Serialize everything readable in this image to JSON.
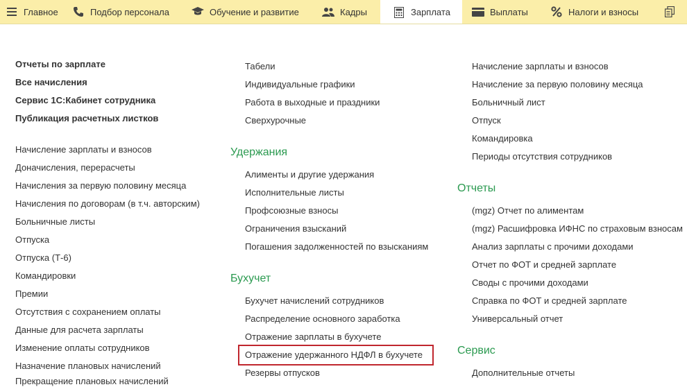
{
  "nav": {
    "tabs": [
      {
        "label": "Главное",
        "icon": "menu-icon"
      },
      {
        "label": "Подбор персонала",
        "icon": "phone-icon"
      },
      {
        "label": "Обучение и развитие",
        "icon": "graduation-cap-icon"
      },
      {
        "label": "Кадры",
        "icon": "users-icon"
      },
      {
        "label": "Зарплата",
        "icon": "calculator-icon",
        "active": true
      },
      {
        "label": "Выплаты",
        "icon": "wallet-icon"
      },
      {
        "label": "Налоги и взносы",
        "icon": "percent-icon"
      },
      {
        "label": "",
        "icon": "copy-icon"
      }
    ]
  },
  "col1": {
    "bold_links": [
      "Отчеты по зарплате",
      "Все начисления",
      "Сервис 1С:Кабинет сотрудника",
      "Публикация расчетных листков"
    ],
    "links": [
      "Начисление зарплаты и взносов",
      "Доначисления, перерасчеты",
      "Начисления за первую половину месяца",
      "Начисления по договорам (в т.ч. авторским)",
      "Больничные листы",
      "Отпуска",
      "Отпуска (Т-6)",
      "Командировки",
      "Премии",
      "Отсутствия с сохранением оплаты",
      "Данные для расчета зарплаты",
      "Изменение оплаты сотрудников",
      "Назначение плановых начислений",
      "Прекращение плановых начислений"
    ]
  },
  "col2": {
    "top_links": [
      "Табели",
      "Индивидуальные графики",
      "Работа в выходные и праздники",
      "Сверхурочные"
    ],
    "deductions": {
      "title": "Удержания",
      "links": [
        "Алименты и другие удержания",
        "Исполнительные листы",
        "Профсоюзные взносы",
        "Ограничения взысканий",
        "Погашения задолженностей по взысканиям"
      ]
    },
    "accounting": {
      "title": "Бухучет",
      "links": [
        "Бухучет начислений сотрудников",
        "Распределение основного заработка",
        "Отражение зарплаты в бухучете",
        "Отражение удержанного НДФЛ в бухучете",
        "Резервы отпусков"
      ]
    }
  },
  "col3": {
    "top_links": [
      "Начисление зарплаты и взносов",
      "Начисление за первую половину месяца",
      "Больничный лист",
      "Отпуск",
      "Командировка",
      "Периоды отсутствия сотрудников"
    ],
    "reports": {
      "title": "Отчеты",
      "links": [
        "(mgz) Отчет по алиментам",
        "(mgz) Расшифровка ИФНС по страховым взносам",
        "Анализ зарплаты с прочими доходами",
        "Отчет по ФОТ и средней зарплате",
        "Своды с прочими доходами",
        "Справка по ФОТ и средней зарплате",
        "Универсальный отчет"
      ]
    },
    "service": {
      "title": "Сервис",
      "links": [
        "Дополнительные отчеты"
      ]
    }
  },
  "colors": {
    "topbar": "#fbeea9",
    "section": "#2b9a50",
    "highlight": "#c0262d"
  }
}
